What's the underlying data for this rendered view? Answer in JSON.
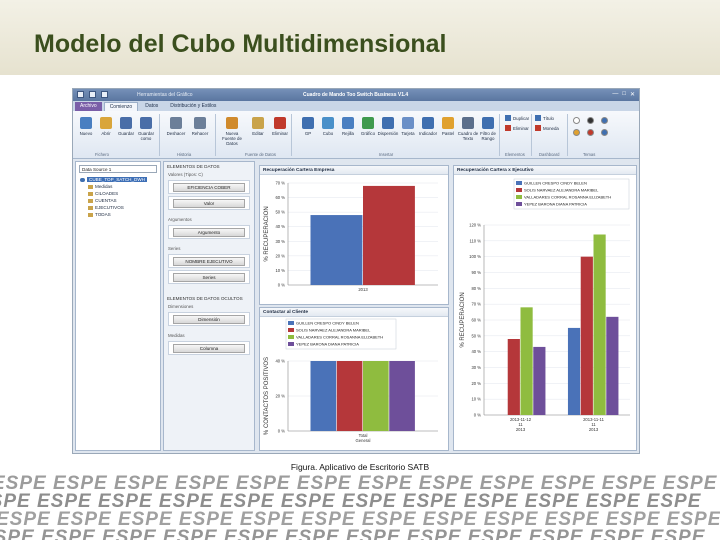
{
  "slide": {
    "title": "Modelo del Cubo Multidimensional",
    "caption": "Figura. Aplicativo de Escritorio SATB",
    "watermark_text": "ESPE"
  },
  "window": {
    "app_name": "Herramientas del Gráfico",
    "title": "Cuadro de Mando Too Switch Business V1.4",
    "controls": [
      "—",
      "□",
      "✕"
    ]
  },
  "tabs": [
    {
      "label": "Archivo"
    },
    {
      "label": "Comienzo"
    },
    {
      "label": "Datos"
    },
    {
      "label": "Distribución y Estilos"
    }
  ],
  "ribbon": {
    "buttons": [
      {
        "label": "Nuevo",
        "icon": "new-file-icon",
        "color": "#4a7fc1"
      },
      {
        "label": "Abrir",
        "icon": "open-folder-icon",
        "color": "#d9a53a"
      },
      {
        "label": "Guardar",
        "icon": "save-icon",
        "color": "#4a6ea8"
      },
      {
        "label": "Guardar como",
        "icon": "save-as-icon",
        "color": "#4a6ea8"
      },
      {
        "label": "Deshacer",
        "icon": "undo-icon",
        "color": "#6c7f99"
      },
      {
        "label": "Rehacer",
        "icon": "redo-icon",
        "color": "#6c7f99"
      },
      {
        "label": "Nueva Fuente de Datos",
        "icon": "data-source-icon",
        "color": "#d08a2c"
      },
      {
        "label": "Editar",
        "icon": "edit-icon",
        "color": "#c9a34a"
      },
      {
        "label": "Eliminar",
        "icon": "delete-icon",
        "color": "#c0392b"
      },
      {
        "label": "GP",
        "icon": "pivot-icon",
        "color": "#3f6fb0"
      },
      {
        "label": "Cubo",
        "icon": "cube-icon",
        "color": "#4a90c9"
      },
      {
        "label": "Rejilla",
        "icon": "grid-icon",
        "color": "#4a7fc1"
      },
      {
        "label": "Gráfico",
        "icon": "chart-icon",
        "color": "#3f9a4e"
      },
      {
        "label": "Dispersión",
        "icon": "scatter-icon",
        "color": "#3f6fb0"
      },
      {
        "label": "Tarjeta",
        "icon": "card-icon",
        "color": "#6a8fc7"
      },
      {
        "label": "Indicador",
        "icon": "gauge-icon",
        "color": "#3f6fb0"
      },
      {
        "label": "Pastel",
        "icon": "pie-icon",
        "color": "#e0a12f"
      },
      {
        "label": "Cuadro de Texto",
        "icon": "textbox-icon",
        "color": "#5b6f8c"
      },
      {
        "label": "Filtro de Rango",
        "icon": "range-filter-icon",
        "color": "#3f6fb0"
      }
    ],
    "small_buttons": [
      {
        "label": "Duplicar",
        "icon": "duplicate-icon",
        "color": "#3f6fb0"
      },
      {
        "label": "Eliminar",
        "icon": "remove-icon",
        "color": "#c0392b"
      },
      {
        "label": "Título",
        "icon": "title-icon",
        "color": "#3f6fb0"
      },
      {
        "label": "Moneda",
        "icon": "currency-icon",
        "color": "#c0392b"
      }
    ],
    "groups": [
      "Fichero",
      "Historia",
      "Fuente de Datos",
      "Insertar",
      "Elementos",
      "Dashboard",
      "Temas"
    ]
  },
  "left_panel": {
    "data_source": "Data Source 1",
    "tree": [
      {
        "label": "CUBE_TOP_SATCH_DWH",
        "root": true
      },
      {
        "label": "Medidas"
      },
      {
        "label": "CILOADES"
      },
      {
        "label": "CUENTAS"
      },
      {
        "label": "EJECUTIVOS"
      },
      {
        "label": "TODAS"
      }
    ]
  },
  "mid_panel": {
    "header": "Elementos de Datos",
    "values_label": "Valores (Tipos: C)",
    "values": [
      "EFICIENCIA COBER",
      "Valor"
    ],
    "arguments_label": "Argumentos",
    "argument": "Argumento",
    "series_label": "Series",
    "series_items": [
      "NOMBRE EJECUTIVO",
      "Series"
    ],
    "hidden_header": "Elementos de Datos Ocultos",
    "dimensions_label": "Dimensiones",
    "dimension": "Dimensión",
    "measures_label": "Medidas",
    "measure": "Columna"
  },
  "colors": {
    "blue": "#4a72b8",
    "red": "#b5373a",
    "green": "#8fbc3f",
    "purple": "#6e4f9a"
  },
  "chart_data": [
    {
      "type": "bar",
      "title": "Recuperación Cartera Empresa",
      "ylabel": "% RECUPERACION",
      "categories": [
        "2013"
      ],
      "series": [
        {
          "values": [
            48
          ]
        },
        {
          "values": [
            68
          ]
        }
      ],
      "ylim": [
        0,
        70
      ],
      "yticks": [
        "0 %",
        "10 %",
        "20 %",
        "30 %",
        "40 %",
        "50 %",
        "60 %",
        "70 %"
      ]
    },
    {
      "type": "bar",
      "title": "Recuperación Cartera x Ejecutivo",
      "ylabel": "% RECUPERACION",
      "categories": [
        "2013-11-12 11 2013",
        "2013-11-11 11 2013"
      ],
      "series": [
        {
          "name": "GUILLEN CRESPO CINDY BELEN",
          "values": [
            null,
            55
          ]
        },
        {
          "name": "SOLIS NARVAEZ ALEJANDRA MARIBEL",
          "values": [
            48,
            100
          ]
        },
        {
          "name": "VALLADARES CORRAL ROSANNA ELIZABETH",
          "values": [
            68,
            114
          ]
        },
        {
          "name": "YEPEZ BARONA DIANA PATRICIA",
          "values": [
            43,
            62
          ]
        }
      ],
      "ylim": [
        0,
        100
      ],
      "yticks": [
        "0 %",
        "10 %",
        "20 %",
        "30 %",
        "40 %",
        "50 %",
        "60 %",
        "70 %",
        "80 %",
        "90 %",
        "100 %",
        "110 %",
        "120 %"
      ]
    },
    {
      "type": "bar",
      "title": "Contactar al Cliente",
      "ylabel": "% CONTACTOS POSITIVOS",
      "categories": [
        "Total General"
      ],
      "series": [
        {
          "name": "GUILLEN CRESPO CINDY BELEN",
          "values": [
            40
          ]
        },
        {
          "name": "SOLIS NARVAEZ ALEJANDRA MARIBEL",
          "values": [
            40
          ]
        },
        {
          "name": "VALLADARES CORRAL ROSANNA ELIZABETH",
          "values": [
            40
          ]
        },
        {
          "name": "YEPEZ BARONA DIANA PATRICIA",
          "values": [
            40
          ]
        }
      ],
      "ylim": [
        0,
        40
      ],
      "yticks": [
        "0 %",
        "20 %",
        "40 %"
      ]
    }
  ]
}
